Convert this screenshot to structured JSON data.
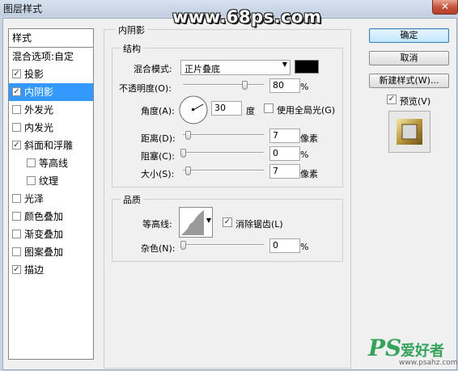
{
  "window": {
    "title": "图层样式",
    "close_glyph": "✕"
  },
  "watermark": "www.68ps.com",
  "sidebar": {
    "header": "样式",
    "blend": "混合选项:自定",
    "items": [
      {
        "label": "投影",
        "checked": true
      },
      {
        "label": "内阴影",
        "checked": true,
        "selected": true
      },
      {
        "label": "外发光",
        "checked": false
      },
      {
        "label": "内发光",
        "checked": false
      },
      {
        "label": "斜面和浮雕",
        "checked": true
      },
      {
        "label": "等高线",
        "checked": false,
        "sub": true
      },
      {
        "label": "纹理",
        "checked": false,
        "sub": true
      },
      {
        "label": "光泽",
        "checked": false
      },
      {
        "label": "颜色叠加",
        "checked": false
      },
      {
        "label": "渐变叠加",
        "checked": false
      },
      {
        "label": "图案叠加",
        "checked": false
      },
      {
        "label": "描边",
        "checked": true
      }
    ]
  },
  "panel": {
    "section_title": "内阴影",
    "structure": {
      "title": "结构",
      "blend_mode_label": "混合模式:",
      "blend_mode_value": "正片叠底",
      "blend_color": "#000000",
      "opacity_label": "不透明度(O):",
      "opacity_value": "80",
      "opacity_unit": "%",
      "angle_label": "角度(A):",
      "angle_value": "30",
      "angle_unit": "度",
      "global_light_label": "使用全局光(G)",
      "global_light_checked": false,
      "distance_label": "距离(D):",
      "distance_value": "7",
      "distance_unit": "像素",
      "choke_label": "阻塞(C):",
      "choke_value": "0",
      "choke_unit": "%",
      "size_label": "大小(S):",
      "size_value": "7",
      "size_unit": "像素"
    },
    "quality": {
      "title": "品质",
      "contour_label": "等高线:",
      "antialias_label": "消除锯齿(L)",
      "antialias_checked": true,
      "noise_label": "杂色(N):",
      "noise_value": "0",
      "noise_unit": "%"
    }
  },
  "buttons": {
    "ok": "确定",
    "cancel": "取消",
    "new_style": "新建样式(W)...",
    "preview_label": "预览(V)",
    "preview_checked": true
  },
  "branding": {
    "ps": "PS",
    "cn": "爱好者",
    "url": "www.psahz.com"
  },
  "colors": {
    "selection": "#3399ff",
    "brand_green": "#35a35c"
  }
}
